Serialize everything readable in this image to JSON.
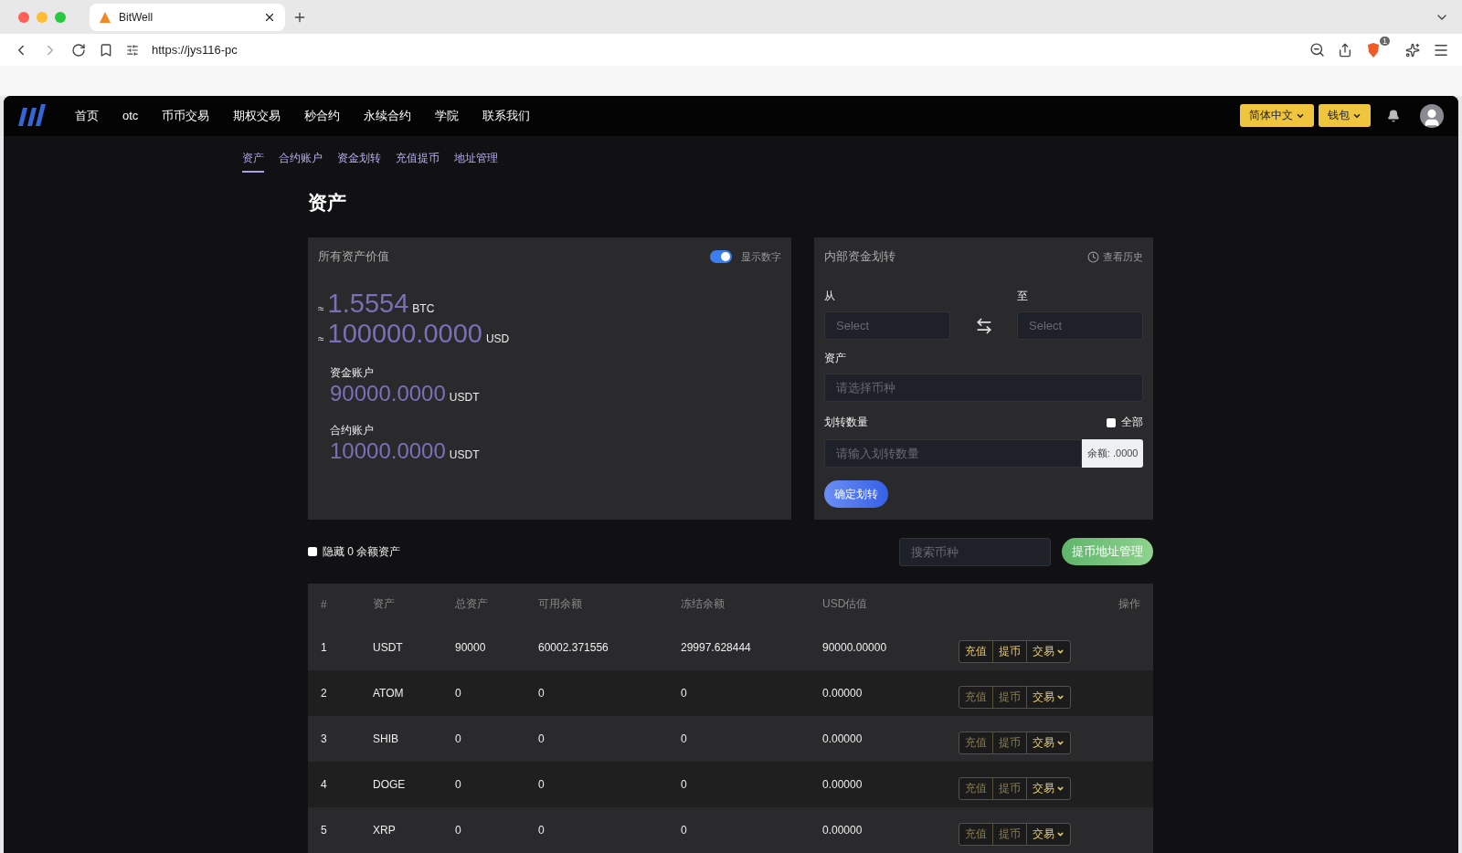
{
  "browser": {
    "tab_title": "BitWell",
    "url": "https://jys116-pc",
    "shield_badge": "1"
  },
  "nav": {
    "items": [
      {
        "label": "首页"
      },
      {
        "label": "otc"
      },
      {
        "label": "币币交易"
      },
      {
        "label": "期权交易"
      },
      {
        "label": "秒合约"
      },
      {
        "label": "永续合约"
      },
      {
        "label": "学院"
      },
      {
        "label": "联系我们"
      }
    ],
    "language": "简体中文",
    "wallet": "钱包"
  },
  "subnav": [
    {
      "label": "资产",
      "selected": true
    },
    {
      "label": "合约账户",
      "selected": false
    },
    {
      "label": "资金划转",
      "selected": false
    },
    {
      "label": "充值提币",
      "selected": false
    },
    {
      "label": "地址管理",
      "selected": false
    }
  ],
  "page_title": "资产",
  "overview": {
    "title": "所有资产价值",
    "show_numbers": {
      "label": "显示数字",
      "on": true
    },
    "totals": [
      {
        "prefix": "≈",
        "value": "1.5554",
        "unit": "BTC"
      },
      {
        "prefix": "≈",
        "value": "100000.0000",
        "unit": "USD"
      }
    ],
    "accounts": [
      {
        "label": "资金账户",
        "value": "90000.0000",
        "unit": "USDT"
      },
      {
        "label": "合约账户",
        "value": "10000.0000",
        "unit": "USDT"
      }
    ]
  },
  "transfer": {
    "title": "内部资金划转",
    "history": "查看历史",
    "from_label": "从",
    "from_placeholder": "Select",
    "to_label": "至",
    "to_placeholder": "Select",
    "asset_label": "资产",
    "asset_placeholder": "请选择币种",
    "amount_label": "划转数量",
    "all": {
      "label": "全部",
      "checked": false
    },
    "amount_placeholder": "请输入划转数量",
    "balance": "余额: .0000",
    "submit": "确定划转"
  },
  "filters": {
    "hide_zero": {
      "label": "隐藏 0 余额资产",
      "checked": false
    },
    "search_placeholder": "搜索币种",
    "address_button": "提币地址管理"
  },
  "table": {
    "columns": [
      "#",
      "资产",
      "总资产",
      "可用余额",
      "冻结余额",
      "USD估值",
      "操作"
    ],
    "rows": [
      {
        "cells": [
          "1",
          "USDT",
          "90000",
          "60002.371556",
          "29997.628444",
          "90000.00000"
        ],
        "actions": [
          {
            "label": "充值",
            "disabled": false
          },
          {
            "label": "提币",
            "disabled": false
          },
          {
            "label": "交易",
            "disabled": false
          }
        ]
      },
      {
        "cells": [
          "2",
          "ATOM",
          "0",
          "0",
          "0",
          "0.00000"
        ],
        "actions": [
          {
            "label": "充值",
            "disabled": true
          },
          {
            "label": "提币",
            "disabled": true
          },
          {
            "label": "交易",
            "disabled": false
          }
        ]
      },
      {
        "cells": [
          "3",
          "SHIB",
          "0",
          "0",
          "0",
          "0.00000"
        ],
        "actions": [
          {
            "label": "充值",
            "disabled": true
          },
          {
            "label": "提币",
            "disabled": true
          },
          {
            "label": "交易",
            "disabled": false
          }
        ]
      },
      {
        "cells": [
          "4",
          "DOGE",
          "0",
          "0",
          "0",
          "0.00000"
        ],
        "actions": [
          {
            "label": "充值",
            "disabled": true
          },
          {
            "label": "提币",
            "disabled": true
          },
          {
            "label": "交易",
            "disabled": false
          }
        ]
      },
      {
        "cells": [
          "5",
          "XRP",
          "0",
          "0",
          "0",
          "0.00000"
        ],
        "actions": [
          {
            "label": "充值",
            "disabled": true
          },
          {
            "label": "提币",
            "disabled": true
          },
          {
            "label": "交易",
            "disabled": false
          }
        ]
      }
    ]
  }
}
